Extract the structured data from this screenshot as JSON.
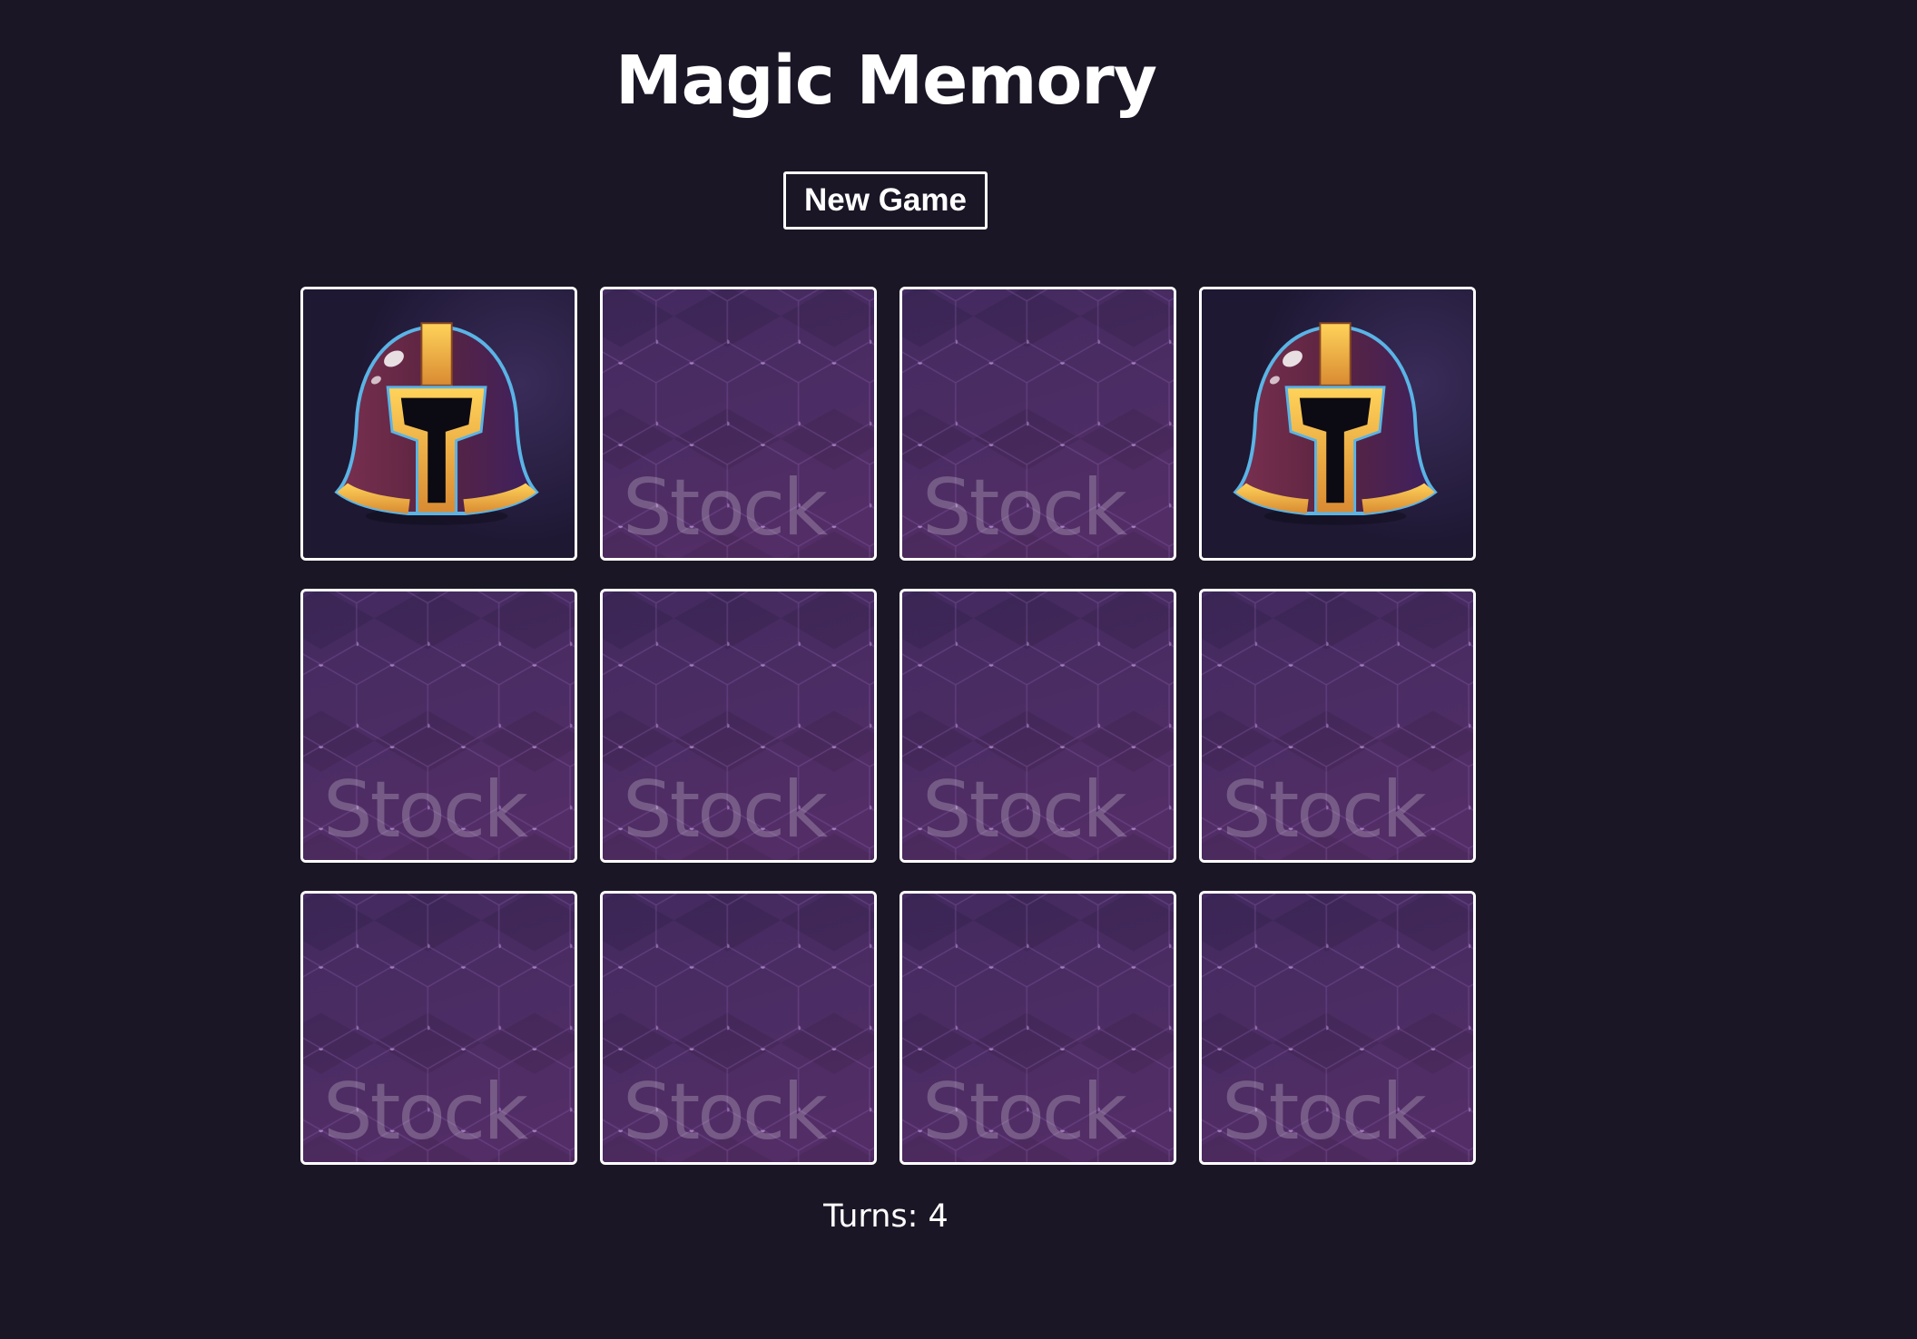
{
  "game": {
    "title": "Magic Memory",
    "new_game_label": "New Game",
    "turns_label": "Turns:",
    "turns": 4
  },
  "cards": [
    {
      "state": "revealed",
      "image": "helmet-icon"
    },
    {
      "state": "hidden",
      "back_watermark": "Stock"
    },
    {
      "state": "hidden",
      "back_watermark": "Stock"
    },
    {
      "state": "revealed",
      "image": "helmet-icon"
    },
    {
      "state": "hidden",
      "back_watermark": "Stock"
    },
    {
      "state": "hidden",
      "back_watermark": "Stock"
    },
    {
      "state": "hidden",
      "back_watermark": "Stock"
    },
    {
      "state": "hidden",
      "back_watermark": "Stock"
    },
    {
      "state": "hidden",
      "back_watermark": "Stock"
    },
    {
      "state": "hidden",
      "back_watermark": "Stock"
    },
    {
      "state": "hidden",
      "back_watermark": "Stock"
    },
    {
      "state": "hidden",
      "back_watermark": "Stock"
    }
  ],
  "colors": {
    "background": "#1b1625",
    "card_border": "#ffffff",
    "card_back_top": "#3a2656",
    "card_back_bottom": "#4d2a5e",
    "hex_line": "#8a5aa8",
    "helmet_shell": "#5a2440",
    "helmet_trim": "#f0b43c",
    "helmet_edge": "#5ab4e6"
  }
}
